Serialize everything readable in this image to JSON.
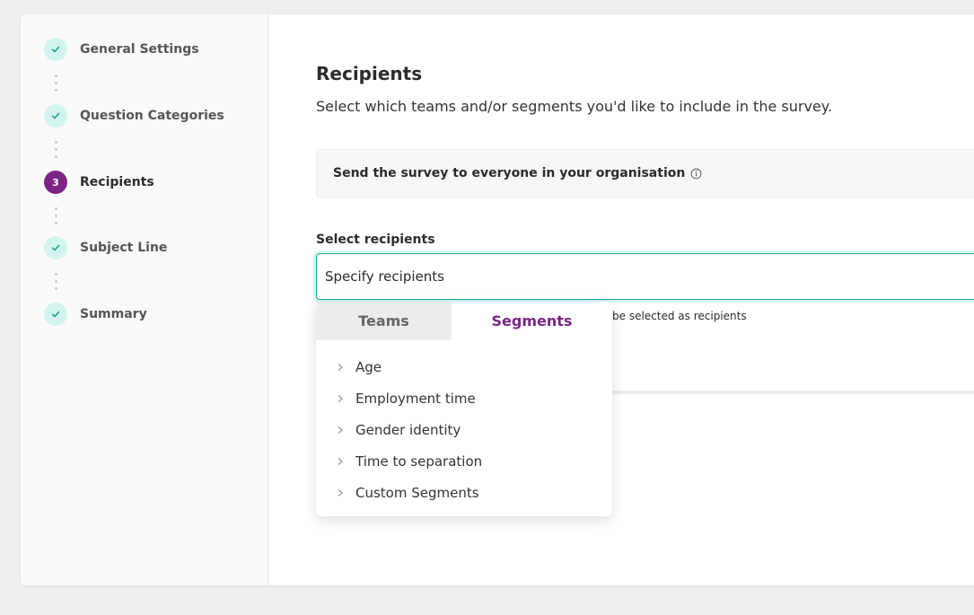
{
  "steps": [
    {
      "label": "General Settings",
      "state": "done"
    },
    {
      "label": "Question Categories",
      "state": "done"
    },
    {
      "label": "Recipients",
      "state": "active",
      "number": "3"
    },
    {
      "label": "Subject Line",
      "state": "done"
    },
    {
      "label": "Summary",
      "state": "done"
    }
  ],
  "main": {
    "title": "Recipients",
    "subtitle": "Select which teams and/or segments you'd like to include in the survey.",
    "everyone_text": "Send the survey to everyone in your organisation",
    "select_label": "Select recipients",
    "input_value": "Specify recipients",
    "helper_text": "be selected as recipients"
  },
  "dropdown": {
    "tabs": {
      "teams": "Teams",
      "segments": "Segments"
    },
    "active_tab": "Segments",
    "segments": [
      "Age",
      "Employment time",
      "Gender identity",
      "Time to separation",
      "Custom Segments"
    ]
  },
  "colors": {
    "accent_purple": "#7b2485",
    "check_green": "#17a589",
    "check_bg": "#d3f4ee",
    "focus_border": "#1aa98e"
  },
  "icons": {
    "done_step": "check-icon",
    "info": "info-icon",
    "segment_expand": "chevron-right-icon"
  }
}
